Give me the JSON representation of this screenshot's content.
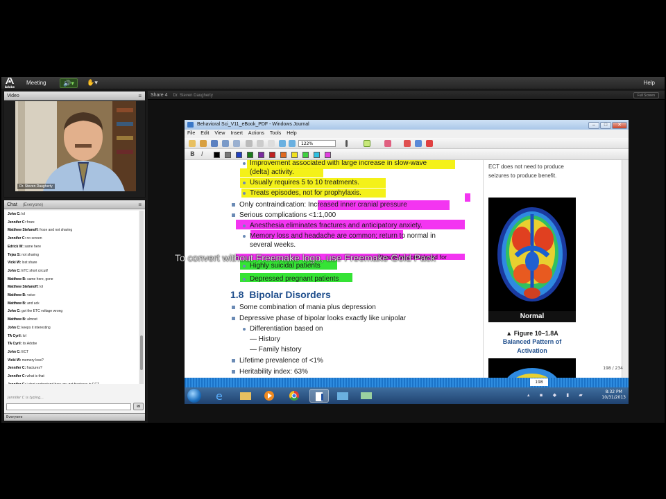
{
  "app": {
    "logo_text": "Adobe",
    "menu_meeting": "Meeting",
    "menu_help": "Help"
  },
  "video_pod": {
    "title": "Video",
    "presenter_name": "Dr. Steven Daugherty"
  },
  "chat_pod": {
    "title": "Chat",
    "audience": "(Everyone)",
    "messages": [
      {
        "user": "John C:",
        "text": "lol"
      },
      {
        "user": "Jennifer C:",
        "text": "froze"
      },
      {
        "user": "Matthew Stefanoff:",
        "text": "froze and not sharing"
      },
      {
        "user": "Jennifer C:",
        "text": "no screen"
      },
      {
        "user": "Edrick W:",
        "text": "same here"
      },
      {
        "user": "Tejas S:",
        "text": "not sharing"
      },
      {
        "user": "Vicki W:",
        "text": "lost share"
      },
      {
        "user": "John C:",
        "text": "ETC short circuit!"
      },
      {
        "user": "Matthew B:",
        "text": "same here, gone"
      },
      {
        "user": "Matthew Stefanoff:",
        "text": "lol"
      },
      {
        "user": "Matthew B:",
        "text": "voice"
      },
      {
        "user": "Matthew B:",
        "text": "and ack"
      },
      {
        "user": "John C:",
        "text": "got the ETC voltage wrong"
      },
      {
        "user": "Matthew B:",
        "text": "almost"
      },
      {
        "user": "John C:",
        "text": "keeps it interesting"
      },
      {
        "user": "TA Cyril:",
        "text": "lol"
      },
      {
        "user": "TA Cyril:",
        "text": "its Adobe"
      },
      {
        "user": "John C:",
        "text": "ECT"
      },
      {
        "user": "Vicki W:",
        "text": "memory loss?"
      },
      {
        "user": "Jennifer C:",
        "text": "fractures?"
      },
      {
        "user": "Jennifer C:",
        "text": "what is that"
      },
      {
        "user": "Jennifer C:",
        "text": "i dont understand how you get fractures in ECT"
      }
    ],
    "typing_status": "Jennifer C is typing...",
    "tab_label": "Everyone"
  },
  "share_pod": {
    "title": "Share 4",
    "presenter": "Dr. Steven Daugherty",
    "fullscreen_label": "Full Screen"
  },
  "journal_window": {
    "title": "Behavioral Sci_V11_eBook_PDF - Windows Journal",
    "menus": [
      "File",
      "Edit",
      "View",
      "Insert",
      "Actions",
      "Tools",
      "Help"
    ],
    "zoom": "122%",
    "page_number": "198",
    "page_count": "198 / 234"
  },
  "document": {
    "lines": {
      "l1": "Improvement associated with large increase in slow-wave",
      "l2": "(delta) activity.",
      "l3": "Usually requires 5 to 10 treatments.",
      "l4": "Treats episodes, not for prophylaxis.",
      "l5a": "Only contraindication:",
      "l5b": "Increased inner cranial pressure",
      "l6": "Serious complications <1:1,000",
      "l7": "Anesthesia eliminates fractures and anticipatory anxiety.",
      "l8": "Memory loss and headache are common; return to normal in",
      "l9": "several weeks.",
      "l10": "Should be considered for",
      "l11": "Highly suicidal patients",
      "l12": "Depressed pregnant patients",
      "l13": "Some combination of mania plus depression",
      "l14": "Depressive phase of bipolar looks exactly like unipolar",
      "l15": "Differentiation based on",
      "l16": "— History",
      "l17": "— Family history",
      "l18": "Lifetime prevalence of <1%",
      "l19": "Heritability index: 63%"
    },
    "section_number": "1.8",
    "section_title": "Bipolar Disorders",
    "side_note_1": "ECT does not need to produce",
    "side_note_2": "seizures to produce benefit.",
    "brain_caption": "Normal",
    "figure_label": "▲ Figure  10–1.8A",
    "figure_caption_1": "Balanced Pattern of",
    "figure_caption_2": "Activation"
  },
  "taskbar": {
    "time": "8:32 PM",
    "date": "10/31/2013"
  },
  "watermark": "To convert without Freemake logo, use Freemake Gold Pack",
  "colors": {
    "highlight_yellow": "#f3f000",
    "highlight_magenta": "#f21ff0",
    "highlight_green": "#1fe01f",
    "section_blue": "#1f4e8c"
  }
}
